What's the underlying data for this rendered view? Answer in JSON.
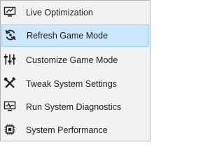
{
  "menu": {
    "items": [
      {
        "label": "Live Optimization",
        "icon": "live-optimization-icon",
        "highlighted": false
      },
      {
        "label": "Refresh Game Mode",
        "icon": "refresh-icon",
        "highlighted": true
      },
      {
        "label": "Customize Game Mode",
        "icon": "sliders-icon",
        "highlighted": false
      },
      {
        "label": "Tweak System Settings",
        "icon": "tools-icon",
        "highlighted": false
      },
      {
        "label": "Run System Diagnostics",
        "icon": "diagnostics-monitor-icon",
        "highlighted": false
      },
      {
        "label": "System Performance",
        "icon": "chip-icon",
        "highlighted": false
      }
    ]
  },
  "colors": {
    "menu_background": "#f2f2f2",
    "menu_border": "#b4b4b4",
    "highlight_background": "#cce8ff",
    "highlight_border": "#99d1ff",
    "icon": "#1f1f1f",
    "text": "#1a1a1a"
  }
}
